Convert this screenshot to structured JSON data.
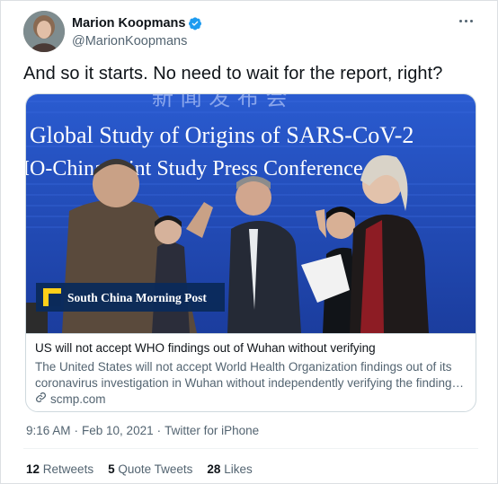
{
  "author": {
    "name": "Marion Koopmans",
    "handle": "@MarionKoopmans"
  },
  "tweet": {
    "text": "And so it starts. No need to wait for the report, right?"
  },
  "card": {
    "image": {
      "banner_line1": "Global Study of Origins of SARS-CoV-2",
      "banner_line2": "IO-China Joint Study Press Conference",
      "top_chars": "新 闻 发 布 会",
      "logo_text": "South China Morning Post"
    },
    "title": "US will not accept WHO findings out of Wuhan without verifying",
    "description_line1": "The United States will not accept World Health Organization findings out of its",
    "description_line2": "coronavirus investigation in Wuhan without independently verifying the findings,...",
    "domain": "scmp.com"
  },
  "meta": {
    "time": "9:16 AM",
    "separator1": "·",
    "date": "Feb 10, 2021",
    "separator2": "·",
    "source": "Twitter for iPhone"
  },
  "stats": {
    "retweets_count": "12",
    "retweets_label": "Retweets",
    "quotes_count": "5",
    "quotes_label": "Quote Tweets",
    "likes_count": "28",
    "likes_label": "Likes"
  },
  "colors": {
    "verified": "#1d9bf0",
    "secondary_text": "#536471",
    "banner_blue": "#1f47b6"
  },
  "icons": {
    "verified": "verified-badge-icon",
    "more": "more-options-icon",
    "link": "link-icon"
  }
}
